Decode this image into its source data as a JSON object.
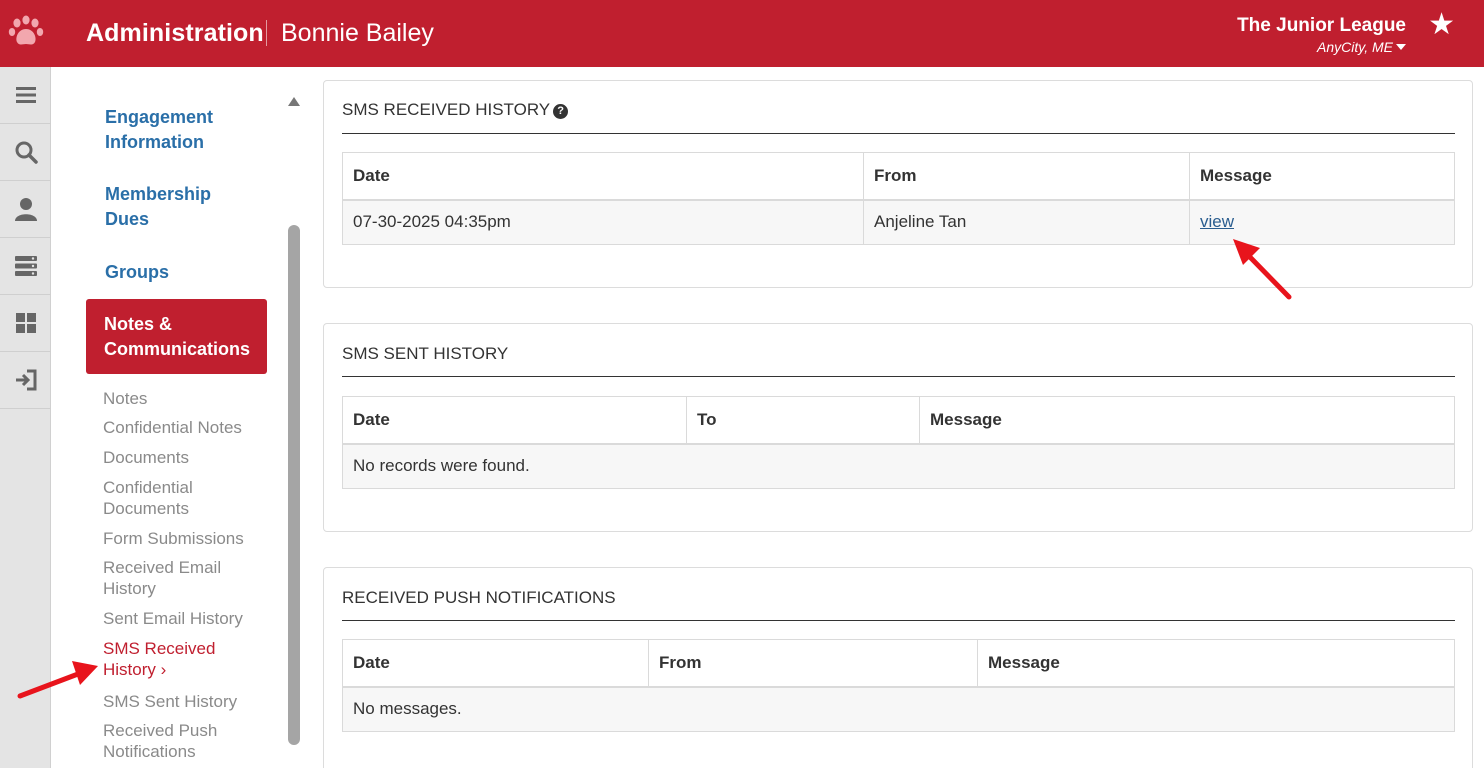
{
  "header": {
    "title": "Administration",
    "member_name": "Bonnie Bailey",
    "org_name": "The Junior League",
    "org_location": "AnyCity, ME",
    "brand_color": "#c01f2f"
  },
  "rail": {
    "icons": [
      "menu-icon",
      "search-icon",
      "person-icon",
      "server-icon",
      "dashboard-icon",
      "logout-icon"
    ]
  },
  "subnav": {
    "sections": [
      {
        "label": "Engagement Information"
      },
      {
        "label": "Membership Dues"
      },
      {
        "label": "Groups"
      }
    ],
    "active_section": "Notes & Communications",
    "items": [
      "Notes",
      "Confidential Notes",
      "Documents",
      "Confidential Documents",
      "Form Submissions",
      "Received Email History",
      "Sent Email History",
      "SMS Received History",
      "SMS Sent History",
      "Received Push Notifications"
    ],
    "current_item_suffix": "›"
  },
  "sms_received": {
    "title": "SMS RECEIVED HISTORY",
    "help": "?",
    "columns": [
      "Date",
      "From",
      "Message"
    ],
    "rows": [
      {
        "date": "07-30-2025 04:35pm",
        "from": "Anjeline Tan",
        "message": "view"
      }
    ]
  },
  "sms_sent": {
    "title": "SMS SENT HISTORY",
    "columns": [
      "Date",
      "To",
      "Message"
    ],
    "empty": "No records were found."
  },
  "push": {
    "title": "RECEIVED PUSH NOTIFICATIONS",
    "columns": [
      "Date",
      "From",
      "Message"
    ],
    "empty": "No messages."
  },
  "annotation_color": "#e8141c"
}
